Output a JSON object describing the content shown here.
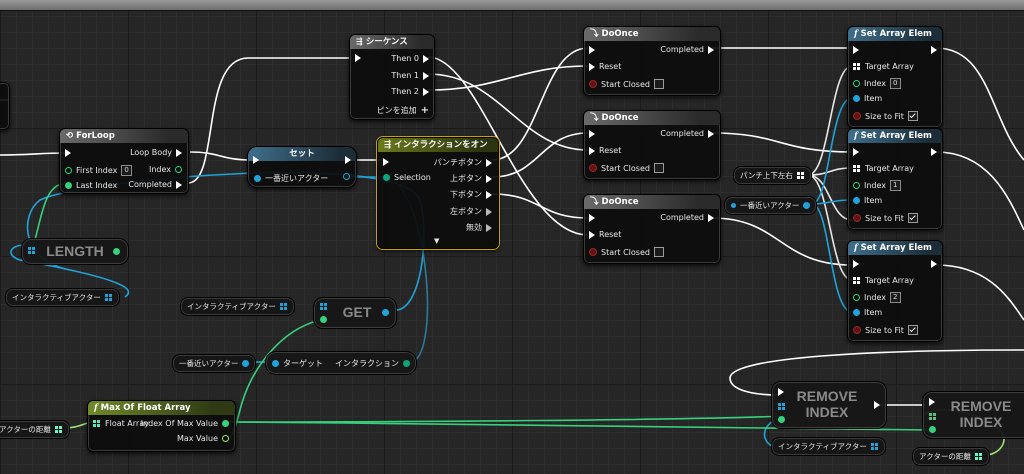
{
  "nodes": {
    "sequence": {
      "title": "シーケンス",
      "then0": "Then 0",
      "then1": "Then 1",
      "then2": "Then 2",
      "add_pin": "ピンを追加"
    },
    "forloop": {
      "title": "ForLoop",
      "first_index": "First Index",
      "first_index_value": "0",
      "last_index": "Last Index",
      "loop_body": "Loop Body",
      "index": "Index",
      "completed": "Completed"
    },
    "set": {
      "title": "セット",
      "var": "一番近いアクター"
    },
    "interaction": {
      "title": "インタラクションをオン",
      "selection": "Selection",
      "punch": "パンチボタン",
      "up": "上ボタン",
      "down": "下ボタン",
      "left": "左ボタン",
      "disabled": "無効"
    },
    "doonce1": {
      "title": "DoOnce",
      "completed": "Completed",
      "reset": "Reset",
      "start_closed": "Start Closed"
    },
    "doonce2": {
      "title": "DoOnce",
      "completed": "Completed",
      "reset": "Reset",
      "start_closed": "Start Closed"
    },
    "doonce3": {
      "title": "DoOnce",
      "completed": "Completed",
      "reset": "Reset",
      "start_closed": "Start Closed"
    },
    "setarr1": {
      "title": "Set Array Elem",
      "target": "Target Array",
      "index": "Index",
      "index_value": "0",
      "item": "Item",
      "size_to_fit": "Size to Fit"
    },
    "setarr2": {
      "title": "Set Array Elem",
      "target": "Target Array",
      "index": "Index",
      "index_value": "1",
      "item": "Item",
      "size_to_fit": "Size to Fit"
    },
    "setarr3": {
      "title": "Set Array Elem",
      "target": "Target Array",
      "index": "Index",
      "index_value": "2",
      "item": "Item",
      "size_to_fit": "Size to Fit"
    },
    "maxfloat": {
      "title": "Max Of Float Array",
      "float_array": "Float Array",
      "index_of_max": "Index Of Max Value",
      "max_value": "Max Value"
    },
    "length": {
      "title": "LENGTH"
    },
    "get": {
      "title": "GET"
    },
    "remove1": {
      "title": "REMOVE INDEX"
    },
    "remove2": {
      "title": "REMOVE INDEX"
    },
    "target_call": {
      "target": "ターゲット",
      "label": "インタラクション"
    }
  },
  "variables": {
    "interactive_actor_1": "インタラクティブアクター",
    "interactive_actor_2": "インタラクティブアクター",
    "interactive_actor_3": "インタラクティブアクター",
    "nearest_actor_1": "一番近いアクター",
    "nearest_actor_2": "一番近いアクター",
    "punch_dirs": "パンチ上下左右",
    "actor_distance_1": "アクターの距離",
    "actor_distance_2": "アクターの距離"
  },
  "colors": {
    "exec_wire": "#ffffff",
    "object_wire": "#1fa3d8",
    "int_wire": "#37d07b",
    "background": "#262626"
  }
}
